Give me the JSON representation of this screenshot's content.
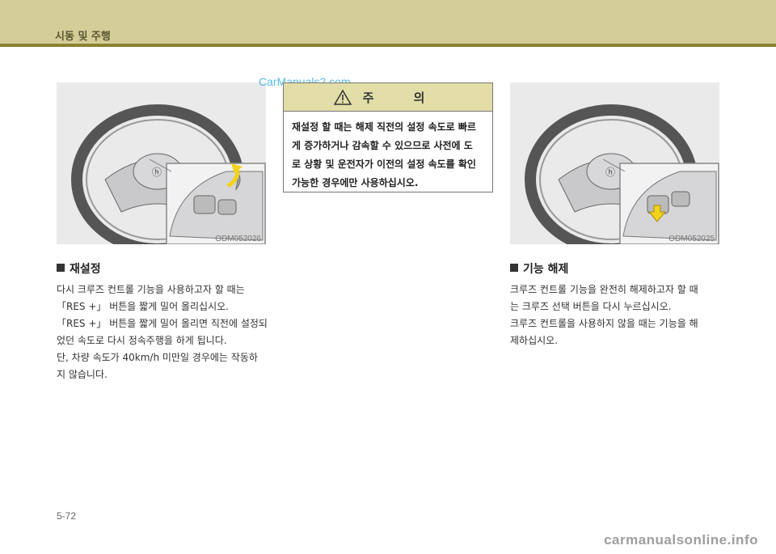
{
  "header": {
    "title": "시동 및 주행"
  },
  "watermark_top": "CarManuals2.com",
  "figures": {
    "left_code": "ODM052026",
    "right_code": "ODM052025"
  },
  "caution": {
    "title": "주 의",
    "lines": [
      "재설정 할 때는 해제 직전의 설정 속도로 빠르",
      "게 증가하거나 감속할 수 있으므로 사전에 도",
      "로 상황 및 운전자가 이전의 설정 속도를 확인",
      "가능한 경우에만 사용하십시오."
    ]
  },
  "reset_section": {
    "title": "재설정",
    "lines": [
      "다시 크루즈 컨트롤 기능을 사용하고자 할 때는",
      "「RES +」 버튼을 짧게 밀어 올리십시오.",
      "「RES +」 버튼을 짧게 밀어 올리면 직전에 설정되",
      "었던 속도로 다시 정속주행을 하게 됩니다.",
      "단, 차량 속도가 40km/h 미만일 경우에는 작동하",
      "지 않습니다."
    ]
  },
  "cancel_section": {
    "title": "기능 해제",
    "lines": [
      "크루즈 컨트롤 기능을 완전히 해제하고자 할 때",
      "는 크루즈 선택 버튼을 다시 누르십시오.",
      "크루즈 컨트롤을 사용하지 않을 때는 기능을 해",
      "제하십시오."
    ]
  },
  "page_number": "5-72",
  "watermark_bottom": "carmanualsonline.info",
  "colors": {
    "header_band": "#d4cd98",
    "header_rule": "#8a8232",
    "caution_head": "#e3dea8",
    "arrow_yellow": "#f2d21a"
  }
}
